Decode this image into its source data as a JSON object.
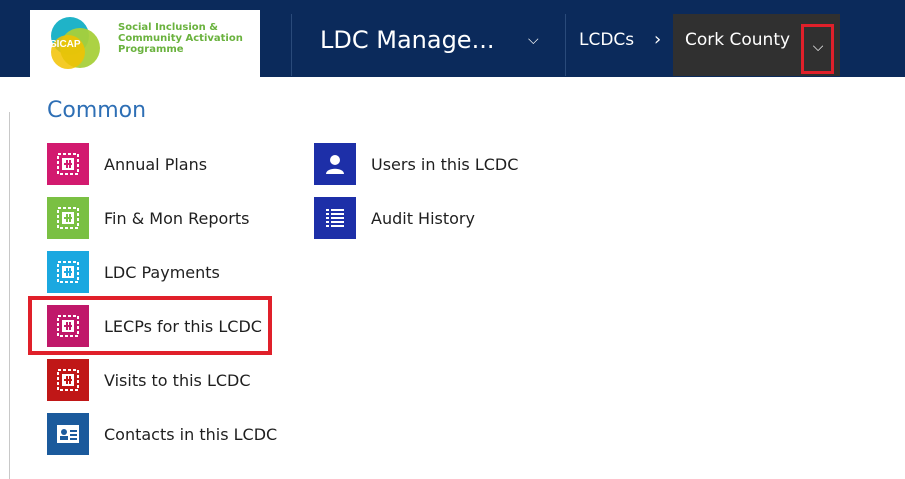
{
  "header": {
    "logo_badge": "SICAP",
    "logo_text": "Social Inclusion & Community Activation Programme",
    "app_title": "LDC Manage...",
    "breadcrumb_root": "LCDCs",
    "breadcrumb_current": "Cork County"
  },
  "menu": {
    "section_title": "Common",
    "items": [
      {
        "label": "Annual Plans",
        "icon": "puzzle-icon",
        "color": "#d21a6f"
      },
      {
        "label": "Fin & Mon Reports",
        "icon": "puzzle-icon",
        "color": "#7ac043"
      },
      {
        "label": "LDC Payments",
        "icon": "puzzle-icon",
        "color": "#1ba8e0"
      },
      {
        "label": "LECPs for this LCDC",
        "icon": "puzzle-icon",
        "color": "#c0186a"
      },
      {
        "label": "Visits to this LCDC",
        "icon": "puzzle-icon",
        "color": "#c01717"
      },
      {
        "label": "Contacts in this LCDC",
        "icon": "contact-card-icon",
        "color": "#1b5a9c"
      },
      {
        "label": "Users in this LCDC",
        "icon": "user-icon",
        "color": "#1d2fa8"
      },
      {
        "label": "Audit History",
        "icon": "list-icon",
        "color": "#1d2fa8"
      }
    ]
  },
  "colors": {
    "topbar": "#0b2a5b",
    "highlight": "#e0202a",
    "section_title": "#2e6fb5"
  }
}
